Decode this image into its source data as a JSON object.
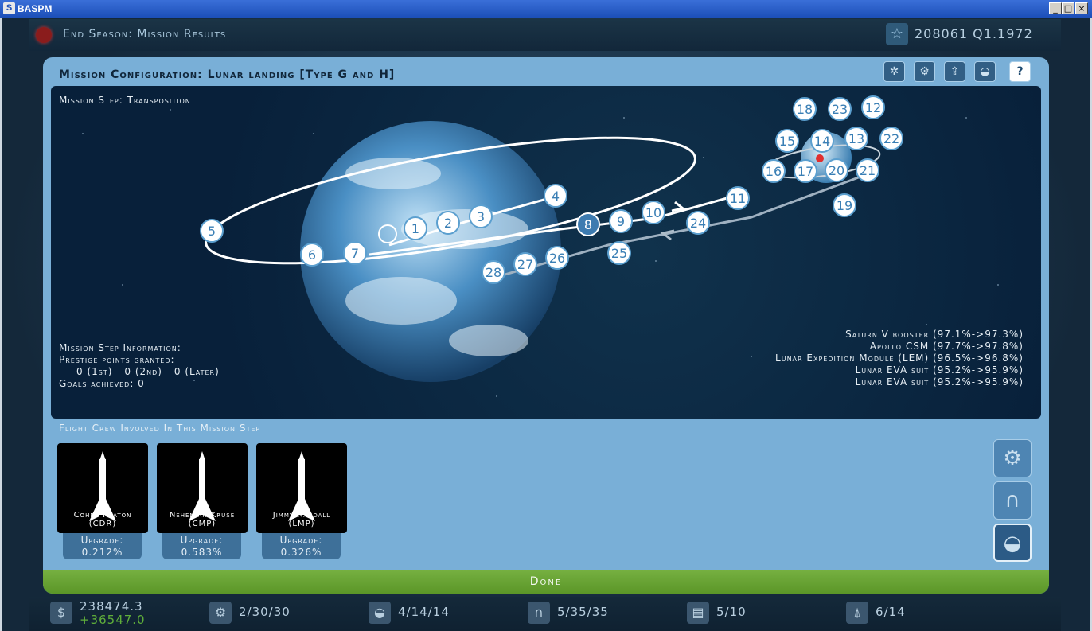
{
  "window": {
    "title": "BASPM"
  },
  "header": {
    "season_title": "End Season: Mission Results",
    "score": "208061 Q1.1972"
  },
  "panel": {
    "title": "Mission Configuration: Lunar landing [Type G and H]",
    "step_title": "Mission Step: Transposition",
    "info": {
      "heading": "Mission Step Information:",
      "prestige_label": "Prestige points granted:",
      "prestige_value": "0 (1st) - 0 (2nd) - 0 (Later)",
      "goals": "Goals achieved: 0"
    },
    "components": [
      "Saturn V booster (97.1%->97.3%)",
      "Apollo CSM (97.7%->97.8%)",
      "Lunar Expedition Module (LEM) (96.5%->96.8%)",
      "Lunar EVA suit (95.2%->95.9%)",
      "Lunar EVA suit (95.2%->95.9%)"
    ],
    "steps": [
      "1",
      "2",
      "3",
      "4",
      "5",
      "6",
      "7",
      "8",
      "9",
      "10",
      "11",
      "12",
      "13",
      "14",
      "15",
      "16",
      "17",
      "18",
      "19",
      "20",
      "21",
      "22",
      "23",
      "24",
      "25",
      "26",
      "27",
      "28"
    ],
    "current_step": "8",
    "crew_label": "Flight Crew Involved In This Mission Step",
    "crew": [
      {
        "name": "Cohen Keaton",
        "role": "(CDR)",
        "upgrade_label": "Upgrade:",
        "upgrade": "0.212%"
      },
      {
        "name": "Nehemiah Kruse",
        "role": "(CMP)",
        "upgrade_label": "Upgrade:",
        "upgrade": "0.583%"
      },
      {
        "name": "Jimmy Randall",
        "role": "(LMP)",
        "upgrade_label": "Upgrade:",
        "upgrade": "0.326%"
      }
    ],
    "done_label": "Done",
    "help_label": "?"
  },
  "bottom": {
    "money": "238474.3",
    "money_delta": "+36547.0",
    "engineers": "2/30/30",
    "astronauts": "4/14/14",
    "controllers": "5/35/35",
    "folders": "5/10",
    "rockets": "6/14"
  },
  "colors": {
    "accent_green": "#6aa535",
    "panel_blue": "#79afd7",
    "space": "#0a2540"
  }
}
